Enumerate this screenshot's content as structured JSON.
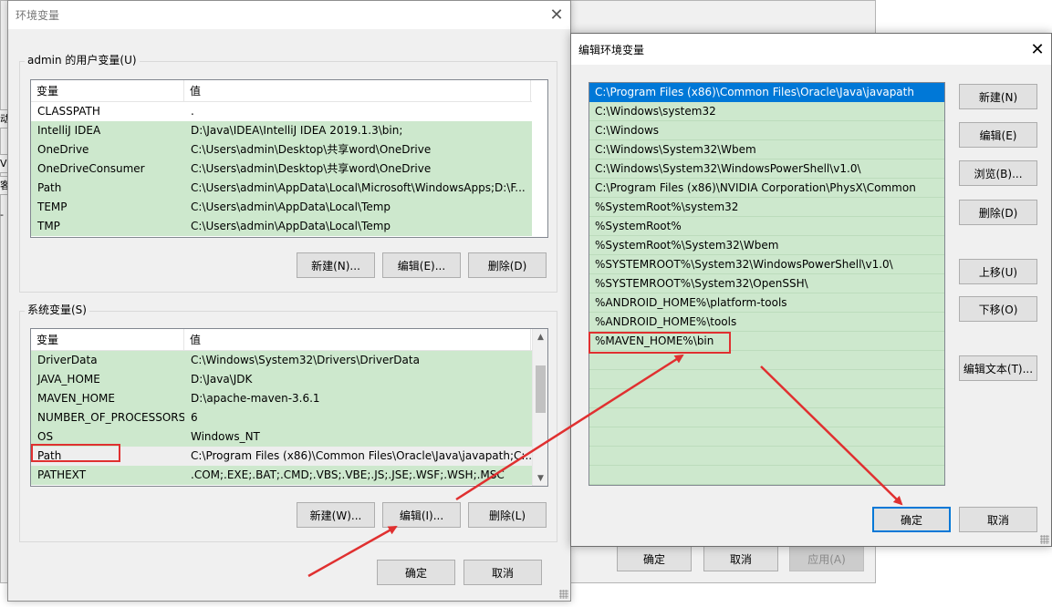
{
  "background_window": {
    "side_tab_chars": [
      "动",
      "V",
      "客",
      "-"
    ],
    "buttons": {
      "ok": "确定",
      "cancel": "取消",
      "apply": "应用(A)"
    }
  },
  "env_dialog": {
    "title": "环境变量",
    "user_group_label": "admin 的用户变量(U)",
    "system_group_label": "系统变量(S)",
    "columns": {
      "variable": "变量",
      "value": "值"
    },
    "user_vars": [
      {
        "name": "CLASSPATH",
        "value": "."
      },
      {
        "name": "IntelliJ IDEA",
        "value": "D:\\Java\\IDEA\\IntelliJ IDEA 2019.1.3\\bin;"
      },
      {
        "name": "OneDrive",
        "value": "C:\\Users\\admin\\Desktop\\共享word\\OneDrive"
      },
      {
        "name": "OneDriveConsumer",
        "value": "C:\\Users\\admin\\Desktop\\共享word\\OneDrive"
      },
      {
        "name": "Path",
        "value": "C:\\Users\\admin\\AppData\\Local\\Microsoft\\WindowsApps;D:\\F..."
      },
      {
        "name": "TEMP",
        "value": "C:\\Users\\admin\\AppData\\Local\\Temp"
      },
      {
        "name": "TMP",
        "value": "C:\\Users\\admin\\AppData\\Local\\Temp"
      }
    ],
    "system_vars": [
      {
        "name": "DriverData",
        "value": "C:\\Windows\\System32\\Drivers\\DriverData"
      },
      {
        "name": "JAVA_HOME",
        "value": "D:\\Java\\JDK"
      },
      {
        "name": "MAVEN_HOME",
        "value": "D:\\apache-maven-3.6.1"
      },
      {
        "name": "NUMBER_OF_PROCESSORS",
        "value": "6"
      },
      {
        "name": "OS",
        "value": "Windows_NT"
      },
      {
        "name": "Path",
        "value": "C:\\Program Files (x86)\\Common Files\\Oracle\\Java\\javapath;C:..."
      },
      {
        "name": "PATHEXT",
        "value": ".COM;.EXE;.BAT;.CMD;.VBS;.VBE;.JS;.JSE;.WSF;.WSH;.MSC"
      }
    ],
    "user_buttons": {
      "new": "新建(N)...",
      "edit": "编辑(E)...",
      "delete": "删除(D)"
    },
    "system_buttons": {
      "new": "新建(W)...",
      "edit": "编辑(I)...",
      "delete": "删除(L)"
    },
    "ok": "确定",
    "cancel": "取消"
  },
  "edit_dialog": {
    "title": "编辑环境变量",
    "entries": [
      "C:\\Program Files (x86)\\Common Files\\Oracle\\Java\\javapath",
      "C:\\Windows\\system32",
      "C:\\Windows",
      "C:\\Windows\\System32\\Wbem",
      "C:\\Windows\\System32\\WindowsPowerShell\\v1.0\\",
      "C:\\Program Files (x86)\\NVIDIA Corporation\\PhysX\\Common",
      "%SystemRoot%\\system32",
      "%SystemRoot%",
      "%SystemRoot%\\System32\\Wbem",
      "%SYSTEMROOT%\\System32\\WindowsPowerShell\\v1.0\\",
      "%SYSTEMROOT%\\System32\\OpenSSH\\",
      "%ANDROID_HOME%\\platform-tools",
      "%ANDROID_HOME%\\tools",
      "%MAVEN_HOME%\\bin"
    ],
    "buttons": {
      "new": "新建(N)",
      "edit": "编辑(E)",
      "browse": "浏览(B)...",
      "delete": "删除(D)",
      "move_up": "上移(U)",
      "move_down": "下移(O)",
      "edit_text": "编辑文本(T)..."
    },
    "ok": "确定",
    "cancel": "取消"
  },
  "colors": {
    "highlight_green": "#cde8cd",
    "selection_blue": "#0078d7",
    "annotation_red": "#e03030"
  }
}
